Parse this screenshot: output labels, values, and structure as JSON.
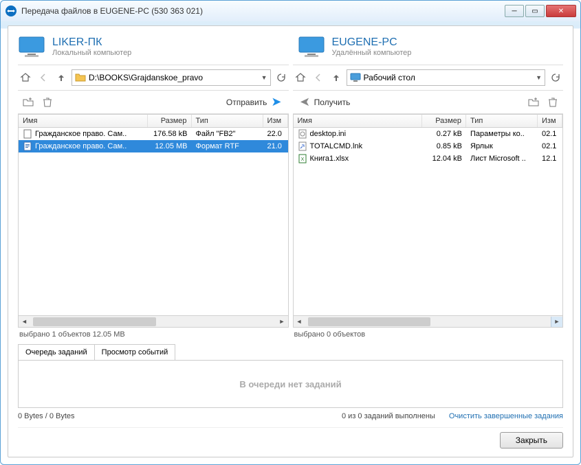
{
  "window": {
    "title": "Передача файлов в EUGENE-PC (530 363 021)"
  },
  "local": {
    "name": "LIKER-ПК",
    "sub": "Локальный компьютер",
    "path": "D:\\BOOKS\\Grajdanskoe_pravo",
    "send_label": "Отправить",
    "cols": {
      "name": "Имя",
      "size": "Размер",
      "type": "Тип",
      "date": "Изм"
    },
    "files": [
      {
        "name": "Гражданское право. Сам..",
        "size": "176.58 kB",
        "type": "Файл \"FB2\"",
        "date": "22.0",
        "icon": "file",
        "selected": false
      },
      {
        "name": "Гражданское право. Сам..",
        "size": "12.05 MB",
        "type": "Формат RTF",
        "date": "21.0",
        "icon": "rtf",
        "selected": true
      }
    ],
    "status": "выбрано 1 объектов  12.05 MB"
  },
  "remote": {
    "name": "EUGENE-PC",
    "sub": "Удалённый компьютер",
    "path": "Рабочий стол",
    "recv_label": "Получить",
    "cols": {
      "name": "Имя",
      "size": "Размер",
      "type": "Тип",
      "date": "Изм"
    },
    "files": [
      {
        "name": "desktop.ini",
        "size": "0.27 kB",
        "type": "Параметры ко..",
        "date": "02.1",
        "icon": "ini",
        "selected": false
      },
      {
        "name": "TOTALCMD.lnk",
        "size": "0.85 kB",
        "type": "Ярлык",
        "date": "02.1",
        "icon": "lnk",
        "selected": false
      },
      {
        "name": "Книга1.xlsx",
        "size": "12.04 kB",
        "type": "Лист Microsoft ..",
        "date": "12.1",
        "icon": "xlsx",
        "selected": false
      }
    ],
    "status": "выбрано 0 объектов"
  },
  "tabs": {
    "queue": "Очередь заданий",
    "events": "Просмотр событий"
  },
  "queue_empty": "В очереди нет заданий",
  "bottom": {
    "bytes": "0 Bytes / 0 Bytes",
    "jobs": "0 из 0 заданий выполнены",
    "clear": "Очистить завершенные задания"
  },
  "close_btn": "Закрыть"
}
